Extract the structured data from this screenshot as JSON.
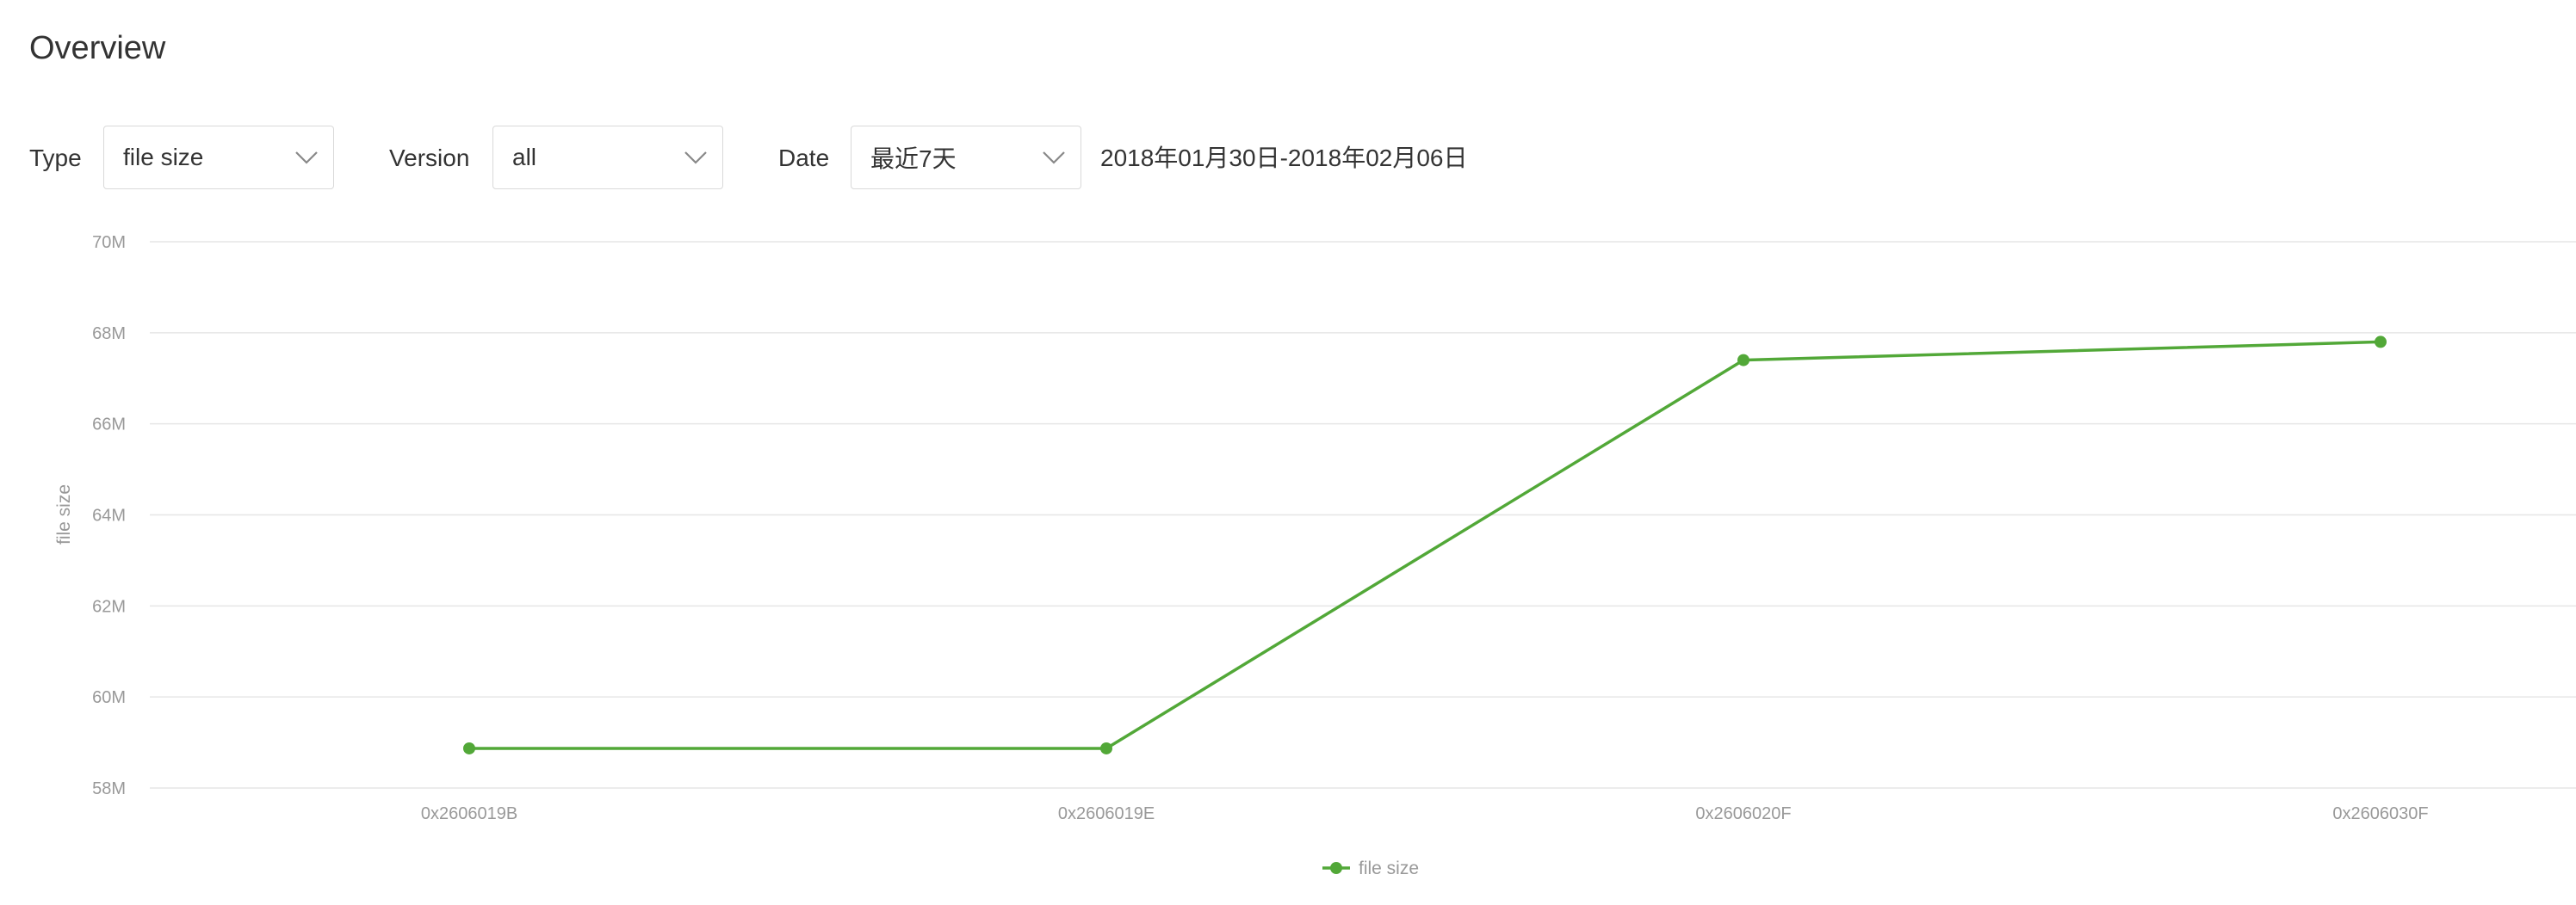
{
  "page": {
    "title": "Overview"
  },
  "filters": {
    "type": {
      "label": "Type",
      "value": "file size"
    },
    "version": {
      "label": "Version",
      "value": "all"
    },
    "date": {
      "label": "Date",
      "value": "最近7天",
      "range": "2018年01月30日-2018年02月06日"
    }
  },
  "icons": {
    "dropdown": "chevron-down-icon"
  },
  "colors": {
    "series": "#52a838",
    "grid": "#e6e6e6",
    "tick_text": "#999999"
  },
  "chart_data": {
    "type": "line",
    "title": "",
    "xlabel": "",
    "ylabel": "file size",
    "ylim": [
      58,
      70
    ],
    "y_unit": "M",
    "y_ticks": [
      58,
      60,
      62,
      64,
      66,
      68,
      70
    ],
    "y_tick_labels": [
      "58M",
      "60M",
      "62M",
      "64M",
      "66M",
      "68M",
      "70M"
    ],
    "categories": [
      "0x2606019B",
      "0x2606019E",
      "0x2606020F",
      "0x2606030F"
    ],
    "series": [
      {
        "name": "file size",
        "values": [
          58.87,
          58.87,
          67.4,
          67.8
        ]
      }
    ],
    "grid": true,
    "legend_position": "bottom-center"
  }
}
